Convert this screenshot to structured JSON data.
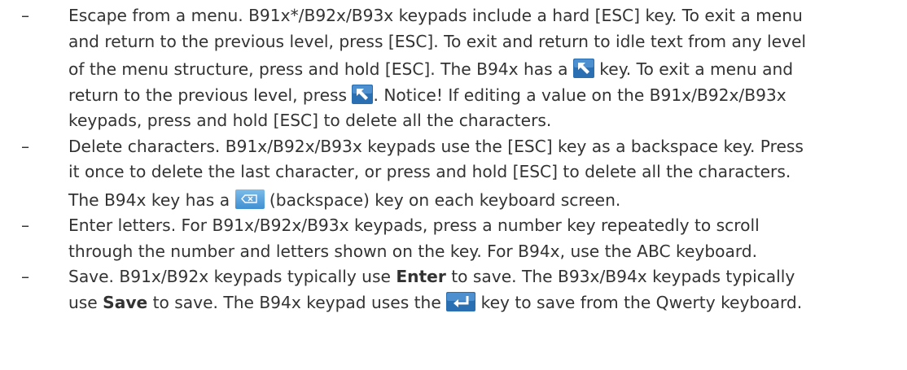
{
  "icons": {
    "back": "back-arrow-icon",
    "backspace": "backspace-icon",
    "enter": "enter-icon"
  },
  "colors": {
    "text": "#333333",
    "back_key": "#2a6fb2",
    "backspace_key": "#4a9bd8",
    "enter_key": "#2a6fb2"
  },
  "items": [
    {
      "bullet": "–",
      "l1": "Escape from a menu. B91x*/B92x/B93x keypads include a hard [ESC] key. To exit a menu",
      "l2": "and return to the previous level, press [ESC]. To exit and return to idle text from any level",
      "l3a": "of the menu structure, press and hold [ESC]. The B94x has a ",
      "l3b": " key. To exit a menu and",
      "l4a": "return to the previous level, press ",
      "l4b": ". Notice! If editing a value on the B91x/B92x/B93x",
      "l5": "keypads, press and hold [ESC] to delete all the characters."
    },
    {
      "bullet": "–",
      "l1": "Delete characters. B91x/B92x/B93x keypads use the [ESC] key as a backspace key. Press",
      "l2": "it once to delete the last character, or press and hold [ESC] to delete all the characters.",
      "l3a": "The B94x key has a ",
      "l3b": " (backspace) key on each keyboard screen."
    },
    {
      "bullet": "–",
      "l1": "Enter letters. For B91x/B92x/B93x keypads, press a number key repeatedly to scroll",
      "l2": "through the number and letters shown on the key. For B94x, use the ABC keyboard."
    },
    {
      "bullet": "–",
      "l1a": "Save. B91x/B92x keypads typically use ",
      "l1b": "Enter",
      "l1c": " to save. The B93x/B94x keypads typically",
      "l2a": "use ",
      "l2b": "Save",
      "l2c": " to save. The B94x keypad uses the ",
      "l2d": " key to save from the Qwerty keyboard."
    }
  ]
}
